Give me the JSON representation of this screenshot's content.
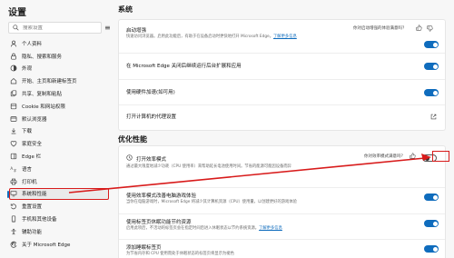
{
  "sidebar": {
    "title": "设置",
    "search_placeholder": "搜索设置",
    "items": [
      {
        "label": "个人资料",
        "icon": "profile-icon"
      },
      {
        "label": "隐私、搜索和服务",
        "icon": "lock-icon"
      },
      {
        "label": "外观",
        "icon": "appearance-icon"
      },
      {
        "label": "开始、主页和新建标签页",
        "icon": "home-icon"
      },
      {
        "label": "共享、复制和粘贴",
        "icon": "share-icon"
      },
      {
        "label": "Cookie 和网站权限",
        "icon": "cookie-icon"
      },
      {
        "label": "默认浏览器",
        "icon": "browser-icon"
      },
      {
        "label": "下载",
        "icon": "download-icon"
      },
      {
        "label": "家庭安全",
        "icon": "family-icon"
      },
      {
        "label": "Edge 栏",
        "icon": "edge-bar-icon"
      },
      {
        "label": "语言",
        "icon": "language-icon"
      },
      {
        "label": "打印机",
        "icon": "printer-icon"
      },
      {
        "label": "系统和性能",
        "icon": "system-icon",
        "active": true
      },
      {
        "label": "重置设置",
        "icon": "reset-icon"
      },
      {
        "label": "手机和其他设备",
        "icon": "phone-icon"
      },
      {
        "label": "辅助功能",
        "icon": "accessibility-icon"
      },
      {
        "label": "关于 Microsoft Edge",
        "icon": "edge-icon"
      }
    ]
  },
  "system": {
    "heading": "系统",
    "startup_title": "启动增强",
    "startup_desc": "快速访问浏览器。启用此功能后，有助于在设备启动时更快地打开 Microsoft Edge。",
    "startup_link": "了解更多信息",
    "feedback": "你对启动增强的体验满意吗？",
    "bg_title": "在 Microsoft Edge 关闭后继续运行后台扩展和应用",
    "hw_title": "使用硬件加速(如可用)",
    "proxy_title": "打开计算机的代理设置"
  },
  "perf": {
    "heading": "优化性能",
    "eff_title": "打开效率模式",
    "eff_desc": "通过最大限度地减少功耗（CPU 使用率）来帮助延长电池使用时间。节省的能源可能因设备而异",
    "feedback": "你对效率模式满意吗？",
    "game_title": "使用效率模式改善电脑游戏体验",
    "game_desc": "当你在电脑游戏时，Microsoft Edge 将减少其计算机资源（CPU）使用量，以创建更好的游戏体验",
    "sleep_title": "使用标签页休眠功能节约资源",
    "sleep_desc": "启用此项后，不活动的标签页会在指定时间后进入休眠状态以节约系统资源。",
    "sleep_link": "了解更多信息",
    "fade_title": "添加睡眠标签页",
    "fade_desc": "为节省内存和 CPU 使用而处于休眠状态的标签页将显示为褪色"
  },
  "colors": {
    "accent": "#0f6cbd",
    "annotation": "#d81b1b"
  }
}
